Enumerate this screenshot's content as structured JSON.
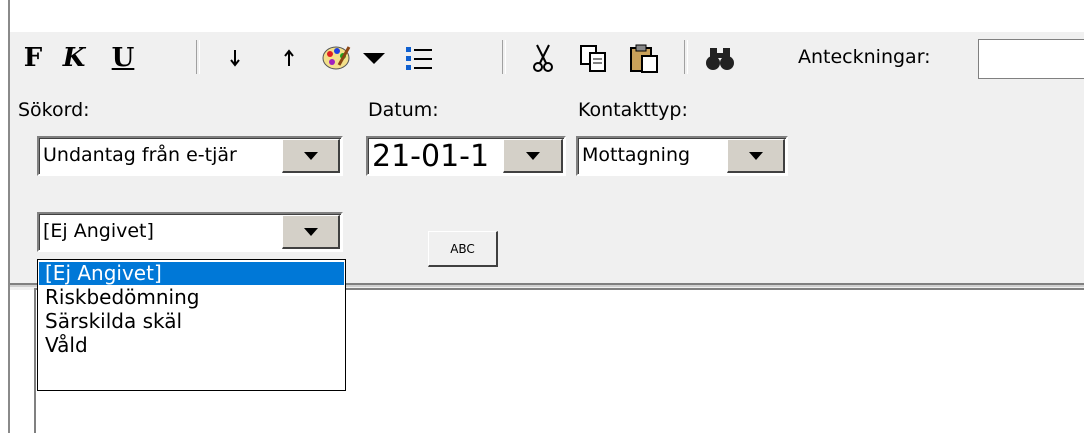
{
  "toolbar": {
    "bold": "F",
    "italic": "K",
    "underline": "U",
    "down_icon": "down-arrow-icon",
    "up_icon": "up-arrow-icon",
    "notes_label": "Anteckningar:",
    "notes_value": ""
  },
  "fields": {
    "sokord": {
      "label": "Sökord:",
      "value": "Undantag från e-tjär"
    },
    "datum": {
      "label": "Datum:",
      "value": "21-01-1"
    },
    "kontakttyp": {
      "label": "Kontakttyp:",
      "value": "Mottagning"
    }
  },
  "category": {
    "value": "[Ej Angivet]",
    "options": [
      "[Ej Angivet]",
      "Riskbedömning",
      "Särskilda skäl",
      "Våld"
    ],
    "selected_index": 0
  },
  "abc_button": "ABC",
  "colors": {
    "selection": "#0078d7",
    "form_bg": "#f0f0f0"
  }
}
